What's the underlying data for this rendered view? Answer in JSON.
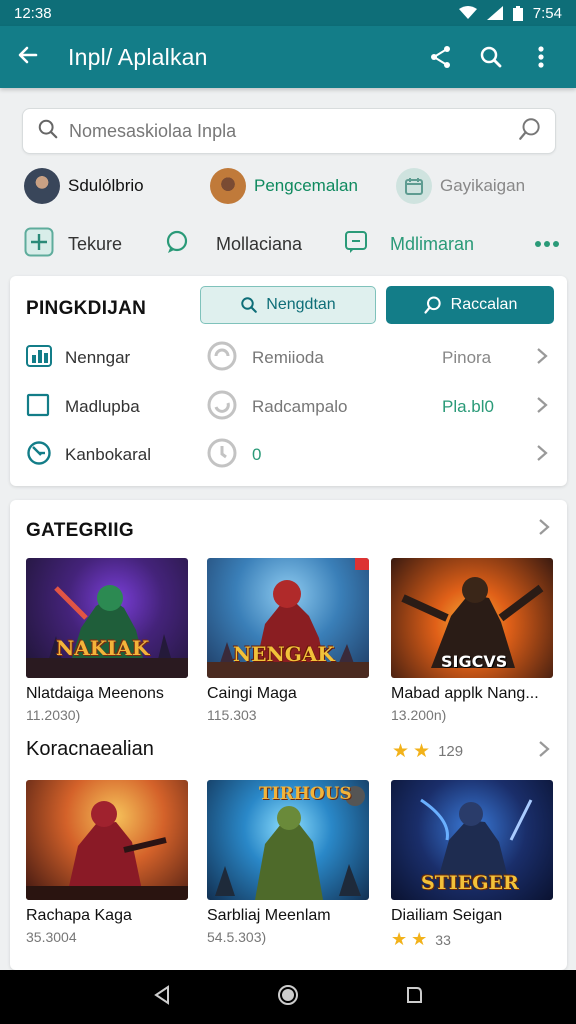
{
  "status": {
    "time": "12:38",
    "clock_right": "7:54"
  },
  "appbar": {
    "title": "Inpl/ Aplalkan"
  },
  "search": {
    "placeholder": "Nomesaskiolaa Inpla"
  },
  "chips": [
    {
      "label": "Sdulólbrio",
      "color": "#111111",
      "avatar": "#39465a"
    },
    {
      "label": "Pengcemalan",
      "color": "#0f8a5f",
      "avatar": "#c07a3a"
    },
    {
      "label": "Gayikaigan",
      "color": "#888888",
      "avatar": "#8ab8b0"
    }
  ],
  "tabs": [
    {
      "label": "Tekure",
      "color": "#333333"
    },
    {
      "label": "Mollaciana",
      "color": "#333333"
    },
    {
      "label": "Mdlimaran",
      "color": "#2a9a78"
    }
  ],
  "section1": {
    "title": "PINGKDIJAN",
    "btn_outline": "Nengdtan",
    "btn_solid": "Raccalan",
    "rows": [
      {
        "label": "Nenngar",
        "mid": "Remiioda",
        "right": "Pinora",
        "right_color": "#888888"
      },
      {
        "label": "Madlupba",
        "mid": "Radcampalo",
        "right": "Pla.bl0",
        "right_color": "#2a9a78"
      },
      {
        "label": "Kanbokaral",
        "mid": "0",
        "right": "",
        "right_color": "#2a9a78"
      }
    ]
  },
  "section2": {
    "title": "GATEGRIIG",
    "subtitle": "Koracnaealian",
    "rating": "129",
    "games_row1": [
      {
        "name": "Nlatdaiga Meenons",
        "sub": "11.2030)",
        "art": "NAKIAK"
      },
      {
        "name": "Caingi Maga",
        "sub": "115.303",
        "art": "NENGAK"
      },
      {
        "name": "Mabad applk Nang...",
        "sub": "13.200n)",
        "art": "SIGCVS"
      }
    ],
    "games_row2": [
      {
        "name": "Rachapa Kaga",
        "sub": "35.3004",
        "art": ""
      },
      {
        "name": "Sarbliaj Meenlam",
        "sub": "54.5.303)",
        "art": "TIRHOUS"
      },
      {
        "name": "Diailiam Seigan",
        "sub": "33",
        "art": "STIEGER"
      }
    ]
  },
  "colors": {
    "primary": "#137d88",
    "primary_dark": "#0e6e78",
    "accent_green": "#2a9a78"
  }
}
